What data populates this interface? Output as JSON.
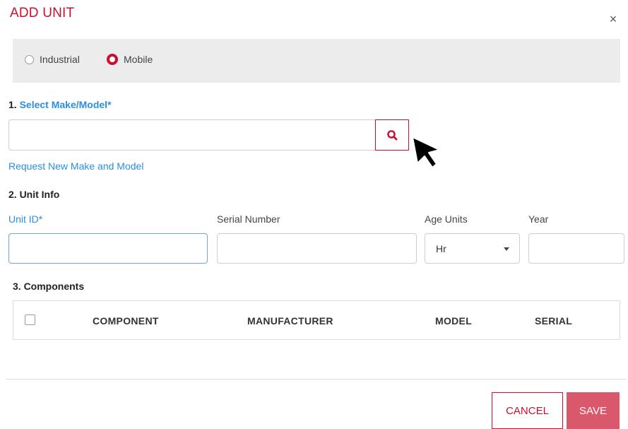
{
  "dialog": {
    "title": "ADD UNIT",
    "close_glyph": "×"
  },
  "unit_type": {
    "options": [
      {
        "label": "Industrial",
        "checked": false
      },
      {
        "label": "Mobile",
        "checked": true
      }
    ]
  },
  "section1": {
    "number": "1.",
    "label": "Select Make/Model*",
    "search_value": "",
    "search_icon": "search-icon",
    "request_link": "Request New Make and Model"
  },
  "section2": {
    "label": "2. Unit Info",
    "unit_id_label": "Unit ID*",
    "unit_id_value": "",
    "serial_label": "Serial Number",
    "serial_value": "",
    "age_units_label": "Age Units",
    "age_units_value": "Hr",
    "year_label": "Year",
    "year_value": ""
  },
  "section3": {
    "label": "3. Components",
    "columns": [
      "COMPONENT",
      "MANUFACTURER",
      "MODEL",
      "SERIAL"
    ]
  },
  "footer": {
    "cancel_label": "CANCEL",
    "save_label": "SAVE"
  },
  "colors": {
    "accent": "#c8102e",
    "link": "#2a8fe0",
    "save_bg": "#d9586b"
  }
}
